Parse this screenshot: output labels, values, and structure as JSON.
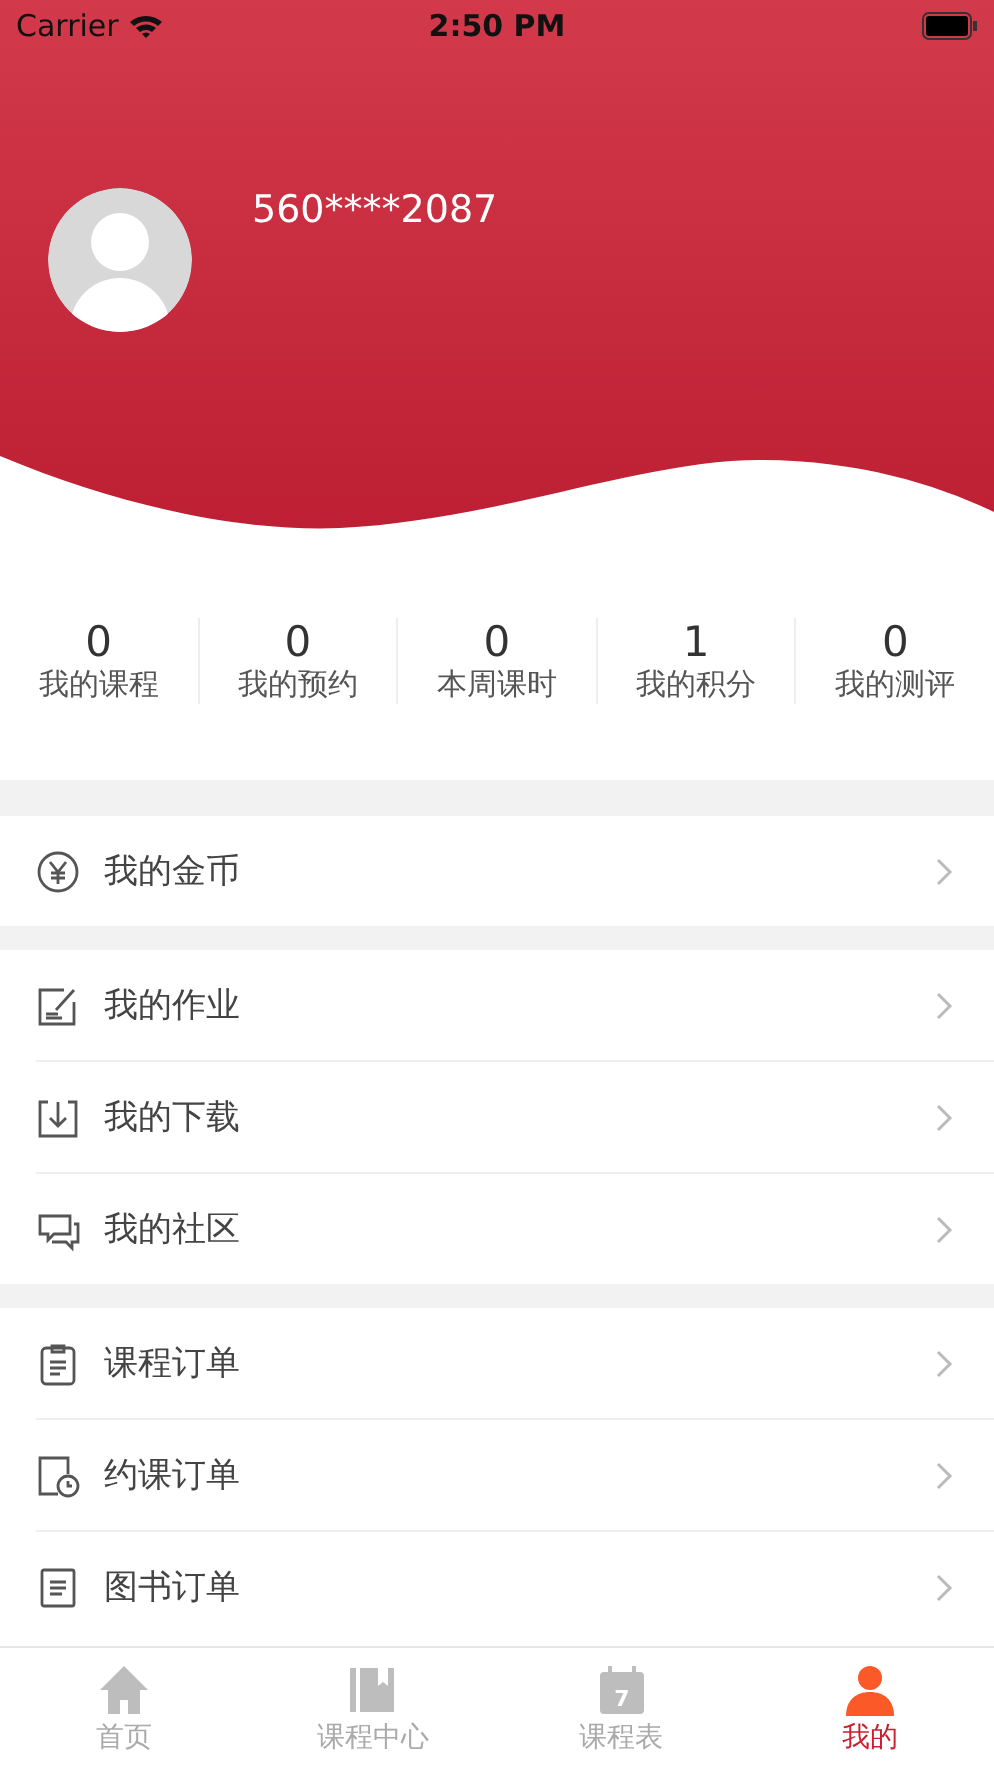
{
  "status_bar": {
    "carrier": "Carrier",
    "time": "2:50 PM"
  },
  "profile": {
    "username": "560****2087"
  },
  "stats": [
    {
      "value": "0",
      "label": "我的课程"
    },
    {
      "value": "0",
      "label": "我的预约"
    },
    {
      "value": "0",
      "label": "本周课时"
    },
    {
      "value": "1",
      "label": "我的积分"
    },
    {
      "value": "0",
      "label": "我的测评"
    }
  ],
  "menu_groups": [
    [
      {
        "kind": "coin",
        "label": "我的金币"
      }
    ],
    [
      {
        "kind": "homework",
        "label": "我的作业"
      },
      {
        "kind": "download",
        "label": "我的下载"
      },
      {
        "kind": "community",
        "label": "我的社区"
      }
    ],
    [
      {
        "kind": "order",
        "label": "课程订单"
      },
      {
        "kind": "booking",
        "label": "约课订单"
      },
      {
        "kind": "book",
        "label": "图书订单"
      }
    ]
  ],
  "tabs": [
    {
      "kind": "home",
      "label": "首页",
      "selected": false
    },
    {
      "kind": "courses",
      "label": "课程中心",
      "selected": false
    },
    {
      "kind": "calendar",
      "label": "课程表",
      "selected": false,
      "icon_text": "7"
    },
    {
      "kind": "me",
      "label": "我的",
      "selected": true
    }
  ]
}
